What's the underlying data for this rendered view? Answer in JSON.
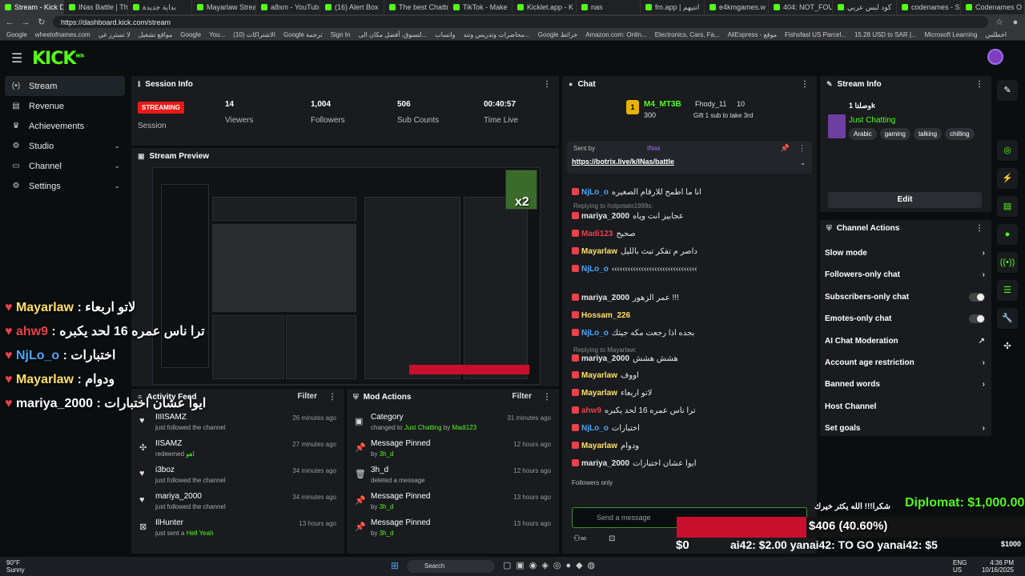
{
  "browser": {
    "tabs": [
      "Stream - Kick D",
      "INas Battle | Th",
      "بداية جديدة",
      "Mayarlaw Strea",
      "a8sm - YouTub",
      "(16) Alert Box",
      "The best Chatb",
      "TikTok - Make",
      "Kicklet.app - K",
      "nas",
      "fm.app | انتيهم",
      "e4kmgames.w",
      "404: NOT_FOU",
      "كود لبس عربي",
      "codenames - S",
      "Codenames O"
    ],
    "url": "https://dashboard.kick.com/stream",
    "bookmarks": [
      "Google",
      "wheelofnames.com",
      "لا تسترز غي",
      "مواقع تشغيل",
      "Google",
      "You...",
      "الاشتراكات (10)",
      "Google ترجمة",
      "Sign In",
      "لتسوق، أفضل مكان الى...",
      "واتساب",
      "محاضرات وتدريس وتند...",
      "Google خرائط",
      "Amazon.com: Onlin...",
      "Electronics, Cars, Fa...",
      "AliExpress - موقع",
      "Fishsfast US Parcel...",
      "15.28 USD to SAR |...",
      "Microsoft Learning",
      "اخطلس"
    ]
  },
  "header": {
    "logo": "KICK",
    "logo_sup": "BETA"
  },
  "sidebar": {
    "items": [
      {
        "label": "Stream",
        "icon": "(•)"
      },
      {
        "label": "Revenue",
        "icon": "▤"
      },
      {
        "label": "Achievements",
        "icon": "♛"
      },
      {
        "label": "Studio",
        "icon": "⚙"
      },
      {
        "label": "Channel",
        "icon": "▭"
      },
      {
        "label": "Settings",
        "icon": "⚙"
      }
    ]
  },
  "session": {
    "title": "Session Info",
    "badge": "STREAMING",
    "label": "Session",
    "stats": [
      {
        "value": "14",
        "label": "Viewers"
      },
      {
        "value": "1,004",
        "label": "Followers"
      },
      {
        "value": "506",
        "label": "Sub Counts"
      },
      {
        "value": "00:40:57",
        "label": "Time Live"
      }
    ]
  },
  "preview": {
    "title": "Stream Preview",
    "badge": "x2"
  },
  "activity": {
    "title": "Activity Feed",
    "filter": "Filter",
    "items": [
      {
        "name": "IIIISAMZ",
        "sub": "just followed the channel",
        "extra": "",
        "time": "26 minutes ago"
      },
      {
        "name": "IISAMZ",
        "sub": "redeemed",
        "extra": "اهو",
        "time": "27 minutes ago"
      },
      {
        "name": "i3boz",
        "sub": "just followed the channel",
        "extra": "",
        "time": "34 minutes ago"
      },
      {
        "name": "mariya_2000",
        "sub": "just followed the channel",
        "extra": "",
        "time": "34 minutes ago"
      },
      {
        "name": "IlHunter",
        "sub": "just sent a",
        "extra": "Hell Yeah",
        "time": "13 hours ago"
      }
    ]
  },
  "mod_actions": {
    "title": "Mod Actions",
    "filter": "Filter",
    "items": [
      {
        "name": "Category",
        "sub": "changed to",
        "g1": "Just Chatting",
        "mid": "by",
        "g2": "Madi123",
        "time": "31 minutes ago"
      },
      {
        "name": "Message Pinned",
        "sub": "by",
        "g1": "3h_d",
        "mid": "",
        "g2": "",
        "time": "12 hours ago"
      },
      {
        "name": "3h_d",
        "sub": "deleted a message",
        "g1": "",
        "mid": "",
        "g2": "",
        "time": "12 hours ago"
      },
      {
        "name": "Message Pinned",
        "sub": "by",
        "g1": "3h_d",
        "mid": "",
        "g2": "",
        "time": "13 hours ago"
      },
      {
        "name": "Message Pinned",
        "sub": "by",
        "g1": "3h_d",
        "mid": "",
        "g2": "",
        "time": "13 hours ago"
      }
    ]
  },
  "chat": {
    "title": "Chat",
    "top_user": "M4_MT3B",
    "top_user_amount": "300",
    "second_user": "Fhody_11",
    "second_amount": "10",
    "gift_text": "Gift 1 sub to take 3rd",
    "pinned_sent_by": "Sent by",
    "pinned_user": "INas",
    "pinned_link": "https://botrix.live/k/INas/battle",
    "messages": [
      {
        "user": "NjLo_o",
        "color": "#4aa8ff",
        "text": "انا ما اطمح للارقام الصغيره"
      },
      {
        "user": "mariya_2000",
        "color": "#e8e8e8",
        "text": "عجابيز انت وياه"
      },
      {
        "user": "Madi123",
        "color": "#e9414a",
        "text": "صحيح"
      },
      {
        "user": "Mayarlaw",
        "color": "#ffe066",
        "text": "داصر م تفكر تبث بالليل"
      },
      {
        "user": "NjLo_o",
        "color": "#4aa8ff",
        "text": "‹‹‹‹‹‹‹‹‹‹‹‹‹‹‹‹‹‹‹‹‹‹‹‹‹‹‹‹‹‹‹‹"
      },
      {
        "user": "mariya_2000",
        "color": "#e8e8e8",
        "text": "عمر الزهور !!!"
      },
      {
        "user": "Hossam_226",
        "color": "#ffe066",
        "text": ""
      },
      {
        "user": "NjLo_o",
        "color": "#4aa8ff",
        "text": "بجده اذا رجعت مكه جيتك"
      },
      {
        "user": "mariya_2000",
        "color": "#e8e8e8",
        "text": "هشش هشش"
      },
      {
        "user": "Mayarlaw",
        "color": "#ffe066",
        "text": "اووف"
      },
      {
        "user": "Mayarlaw",
        "color": "#ffe066",
        "text": "لاتو اربعاء"
      },
      {
        "user": "ahw9",
        "color": "#e9414a",
        "text": "ترا ناس عمره 16 لحد يكبره"
      },
      {
        "user": "NjLo_o",
        "color": "#4aa8ff",
        "text": "اختبارات"
      },
      {
        "user": "Mayarlaw",
        "color": "#ffe066",
        "text": "ودوام"
      },
      {
        "user": "mariya_2000",
        "color": "#e8e8e8",
        "text": "ايوا عشان اختبارات"
      }
    ],
    "reply1": "Replying to hotpotato1999s:",
    "reply2": "Replying to Mayarlaw:",
    "followers_only": "Followers only",
    "input_placeholder": "Send a message",
    "send": "Chat"
  },
  "stream_info": {
    "title": "Stream Info",
    "stream_title": "وصلنا 1k",
    "category": "Just Chatting",
    "tags": [
      "Arabic",
      "gaming",
      "talking",
      "chilling"
    ],
    "edit": "Edit"
  },
  "channel_actions": {
    "title": "Channel Actions",
    "items": [
      {
        "label": "Slow mode",
        "control": "›"
      },
      {
        "label": "Followers-only chat",
        "control": "›"
      },
      {
        "label": "Subscribers-only chat",
        "control": "toggle"
      },
      {
        "label": "Emotes-only chat",
        "control": "toggle"
      },
      {
        "label": "AI Chat Moderation",
        "control": "↗"
      },
      {
        "label": "Account age restriction",
        "control": "›"
      },
      {
        "label": "Banned words",
        "control": "›"
      },
      {
        "label": "Host Channel",
        "control": ""
      },
      {
        "label": "Set goals",
        "control": "›"
      }
    ]
  },
  "overlay": {
    "chat_lines": [
      {
        "user": "Mayarlaw",
        "cls": "uy",
        "text": "لاتو اربعاء"
      },
      {
        "user": "ahw9",
        "cls": "ur",
        "text": "ترا ناس عمره 16 لحد يكبره"
      },
      {
        "user": "NjLo_o",
        "cls": "ub",
        "text": "اختبارات"
      },
      {
        "user": "Mayarlaw",
        "cls": "uy",
        "text": "ودوام"
      },
      {
        "user": "mariya_2000",
        "cls": "uw",
        "text": "ايوا عشان اختبارات"
      }
    ],
    "diplomat": "Diplomat: $1,000.00",
    "goal_text": "$406 (40.60%)",
    "goal_percent": 40.6,
    "goal_start": "$0",
    "thanks": "شكرا!!! الله يكثر خيرك",
    "ticker": "ai42: $2.00   yanai42: TO GO   yanai42: $5",
    "corner": "$1000"
  },
  "taskbar": {
    "weather": "90°F",
    "weather_sub": "Sunny",
    "search": "Search",
    "lang": "ENG",
    "region": "US",
    "time": "4:36 PM",
    "date": "10/16/2025"
  },
  "colors": {
    "accent": "#53fc18",
    "live": "#e91916"
  }
}
